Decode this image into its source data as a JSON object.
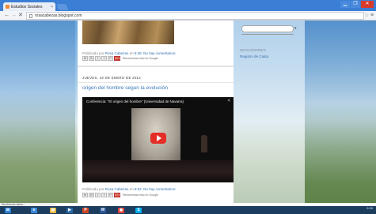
{
  "browser": {
    "tab_title": "Estudios Sociales",
    "tab_close": "×",
    "url": "rosacabezas.blogspot.com",
    "window_buttons": {
      "minimize": "▁",
      "maximize": "❐",
      "close": "✕"
    },
    "nav": {
      "back": "←",
      "forward": "→",
      "reload": "✕"
    },
    "star": "☆",
    "menu": "≡"
  },
  "blog": {
    "post1": {
      "meta_prefix": "Publicado por",
      "author": "Rosa Cabezas",
      "meta_at": "en",
      "time": "6:49",
      "comments": "No hay comentarios:",
      "recommend": "Recomendar esto en Google"
    },
    "post2": {
      "date_header": "JUEVES, 19 DE ENERO DE 2012",
      "title": "origen del hombre segun la evolución",
      "video_title": "Conferencia: \"El origen del hombre\" (Universidad de Navarra)",
      "meta_prefix": "Publicado por",
      "author": "Rosa Cabezas",
      "meta_at": "en",
      "time": "6:53",
      "comments": "No hay comentarios:",
      "recommend": "Recomendar esto en Google"
    },
    "share_buttons": [
      "M",
      "B",
      "t",
      "f",
      "P",
      "G+1"
    ]
  },
  "sidebar": {
    "heading": "SEGUIDORES",
    "link": "Registro de Casta"
  },
  "statusbar": {
    "text": "Recibiendo datos..."
  },
  "taskbar": {
    "apps": [
      {
        "name": "start",
        "glyph": "⊞",
        "color": "#2d7fd3"
      },
      {
        "name": "ie",
        "glyph": "e",
        "color": "#3b8ad9"
      },
      {
        "name": "explorer",
        "glyph": "▤",
        "color": "#e7b33a"
      },
      {
        "name": "media",
        "glyph": "▶",
        "color": "#2a6aa8"
      },
      {
        "name": "powerpoint",
        "glyph": "P",
        "color": "#d24726"
      },
      {
        "name": "word",
        "glyph": "W",
        "color": "#2b5797"
      },
      {
        "name": "chrome",
        "glyph": "◉",
        "color": "#e0463c"
      },
      {
        "name": "skype",
        "glyph": "S",
        "color": "#00aff0"
      }
    ],
    "clock": "6:55"
  },
  "colors": {
    "link": "#2a6fb0",
    "play": "#e52d27",
    "chrome_blue": "#3a7fd5"
  }
}
